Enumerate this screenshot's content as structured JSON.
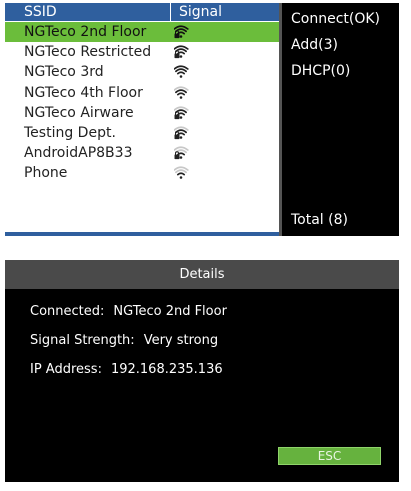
{
  "wifi_list": {
    "header": {
      "ssid": "SSID",
      "signal": "Signal"
    },
    "networks": [
      {
        "ssid": "NGTeco 2nd Floor",
        "signal_icon": "wifi-locked-strong-icon",
        "selected": true
      },
      {
        "ssid": "NGTeco Restricted",
        "signal_icon": "wifi-locked-strong-icon",
        "selected": false
      },
      {
        "ssid": "NGTeco 3rd",
        "signal_icon": "wifi-strong-icon",
        "selected": false
      },
      {
        "ssid": "NGTeco 4th Floor",
        "signal_icon": "wifi-medium-icon",
        "selected": false
      },
      {
        "ssid": "NGTeco Airware",
        "signal_icon": "wifi-locked-medium-icon",
        "selected": false
      },
      {
        "ssid": "Testing Dept.",
        "signal_icon": "wifi-locked-medium-icon",
        "selected": false
      },
      {
        "ssid": "AndroidAP8B33",
        "signal_icon": "wifi-locked-weak-icon",
        "selected": false
      },
      {
        "ssid": "Phone",
        "signal_icon": "wifi-weak-icon",
        "selected": false
      }
    ]
  },
  "side_menu": {
    "connect": "Connect(OK)",
    "add": "Add(3)",
    "dhcp": "DHCP(0)",
    "total": "Total (8)"
  },
  "details": {
    "title": "Details",
    "connected_label": "Connected:",
    "connected_value": "NGTeco 2nd Floor",
    "signal_label": "Signal Strength:",
    "signal_value": "Very strong",
    "ip_label": "IP Address:",
    "ip_value": "192.168.235.136",
    "esc_label": "ESC"
  },
  "colors": {
    "header_blue": "#2f5f9e",
    "selected_green": "#6bbd3b",
    "esc_green": "#66b23e",
    "details_header_gray": "#4a4a4a"
  }
}
